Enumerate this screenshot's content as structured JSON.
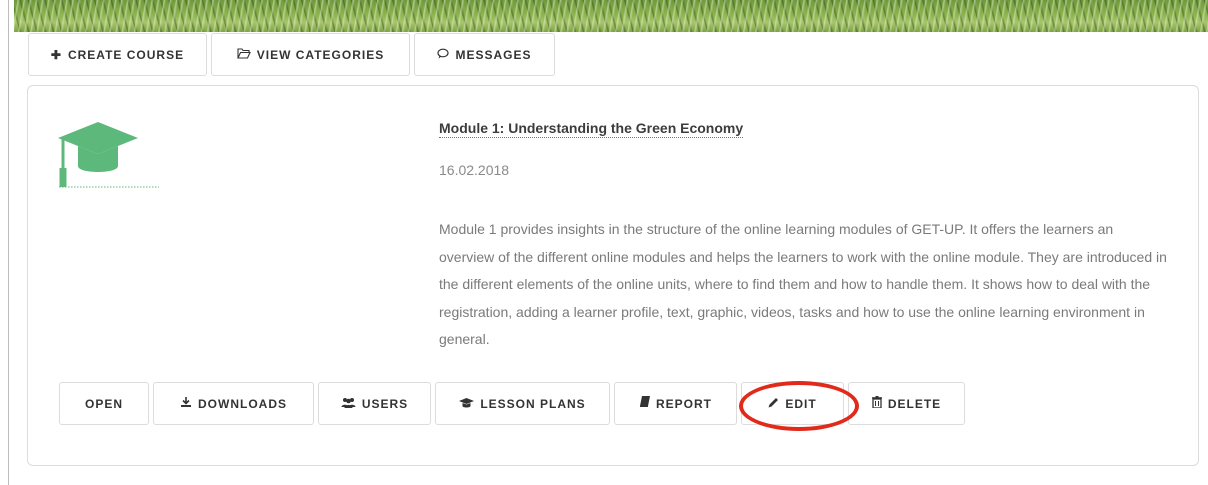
{
  "top_toolbar": {
    "create_course": "CREATE COURSE",
    "view_categories": "VIEW CATEGORIES",
    "messages": "MESSAGES"
  },
  "course": {
    "icon": "graduation-cap-icon",
    "icon_color": "#5cb87b",
    "title": "Module 1: Understanding the Green Economy",
    "date": "16.02.2018",
    "description": "Module 1 provides insights in the structure of the online learning modules of GET-UP. It offers the learners an overview of the different online modules and helps the learners to work with the online module. They are introduced in the different elements of the online units, where to find them and how to handle them. It shows how to deal with the registration, adding a learner profile, text, graphic, videos, tasks and how to use the online learning environment in general."
  },
  "actions": {
    "open": "OPEN",
    "downloads": "DOWNLOADS",
    "users": "USERS",
    "lesson_plans": "LESSON PLANS",
    "report": "REPORT",
    "edit": "EDIT",
    "delete": "DELETE"
  },
  "annotation": {
    "highlight_color": "#e12a1a",
    "highlighted_action": "EDIT"
  }
}
